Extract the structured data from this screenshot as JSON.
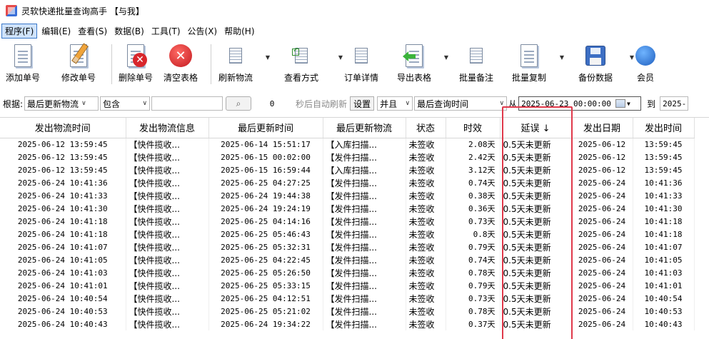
{
  "window": {
    "title": "灵软快递批量查询高手 【与我】"
  },
  "menu": [
    {
      "label": "程序(F)",
      "active": true
    },
    {
      "label": "编辑(E)"
    },
    {
      "label": "查看(S)"
    },
    {
      "label": "数据(B)"
    },
    {
      "label": "工具(T)"
    },
    {
      "label": "公告(X)"
    },
    {
      "label": "帮助(H)"
    }
  ],
  "toolbar": {
    "add": "添加单号",
    "edit": "修改单号",
    "delete": "删除单号",
    "clear": "清空表格",
    "refresh": "刷新物流",
    "view_mode": "查看方式",
    "order_detail": "订单详情",
    "export": "导出表格",
    "batch_note": "批量备注",
    "batch_copy": "批量复制",
    "backup": "备份数据",
    "member": "会员"
  },
  "filter": {
    "basis_label": "根据:",
    "field": "最后更新物流",
    "operator": "包含",
    "value": "",
    "count": "0",
    "auto_refresh": "秒后自动刷新",
    "settings_btn": "设置",
    "logic": "并且",
    "date_field": "最后查询时间",
    "from_label": "从",
    "from_date": "2025-06-23 00:00:00",
    "to_label": "到",
    "to_date": "2025-"
  },
  "table": {
    "headers": [
      "发出物流时间",
      "发出物流信息",
      "最后更新时间",
      "最后更新物流",
      "状态",
      "时效",
      "延误 ↓",
      "发出日期",
      "发出时间"
    ],
    "rows": [
      [
        "2025-06-12 13:59:45",
        "【快件揽收...",
        "2025-06-14 15:51:17",
        "【入库扫描...",
        "未签收",
        "2.08天",
        "0.5天未更新",
        "2025-06-12",
        "13:59:45"
      ],
      [
        "2025-06-12 13:59:45",
        "【快件揽收...",
        "2025-06-15 00:02:00",
        "【发件扫描...",
        "未签收",
        "2.42天",
        "0.5天未更新",
        "2025-06-12",
        "13:59:45"
      ],
      [
        "2025-06-12 13:59:45",
        "【快件揽收...",
        "2025-06-15 16:59:44",
        "【入库扫描...",
        "未签收",
        "3.12天",
        "0.5天未更新",
        "2025-06-12",
        "13:59:45"
      ],
      [
        "2025-06-24 10:41:36",
        "【快件揽收...",
        "2025-06-25 04:27:25",
        "【发件扫描...",
        "未签收",
        "0.74天",
        "0.5天未更新",
        "2025-06-24",
        "10:41:36"
      ],
      [
        "2025-06-24 10:41:33",
        "【快件揽收...",
        "2025-06-24 19:44:38",
        "【发件扫描...",
        "未签收",
        "0.38天",
        "0.5天未更新",
        "2025-06-24",
        "10:41:33"
      ],
      [
        "2025-06-24 10:41:30",
        "【快件揽收...",
        "2025-06-24 19:24:19",
        "【发件扫描...",
        "未签收",
        "0.36天",
        "0.5天未更新",
        "2025-06-24",
        "10:41:30"
      ],
      [
        "2025-06-24 10:41:18",
        "【快件揽收...",
        "2025-06-25 04:14:16",
        "【发件扫描...",
        "未签收",
        "0.73天",
        "0.5天未更新",
        "2025-06-24",
        "10:41:18"
      ],
      [
        "2025-06-24 10:41:18",
        "【快件揽收...",
        "2025-06-25 05:46:43",
        "【发件扫描...",
        "未签收",
        "0.8天",
        "0.5天未更新",
        "2025-06-24",
        "10:41:18"
      ],
      [
        "2025-06-24 10:41:07",
        "【快件揽收...",
        "2025-06-25 05:32:31",
        "【发件扫描...",
        "未签收",
        "0.79天",
        "0.5天未更新",
        "2025-06-24",
        "10:41:07"
      ],
      [
        "2025-06-24 10:41:05",
        "【快件揽收...",
        "2025-06-25 04:22:45",
        "【发件扫描...",
        "未签收",
        "0.74天",
        "0.5天未更新",
        "2025-06-24",
        "10:41:05"
      ],
      [
        "2025-06-24 10:41:03",
        "【快件揽收...",
        "2025-06-25 05:26:50",
        "【发件扫描...",
        "未签收",
        "0.78天",
        "0.5天未更新",
        "2025-06-24",
        "10:41:03"
      ],
      [
        "2025-06-24 10:41:01",
        "【快件揽收...",
        "2025-06-25 05:33:15",
        "【发件扫描...",
        "未签收",
        "0.79天",
        "0.5天未更新",
        "2025-06-24",
        "10:41:01"
      ],
      [
        "2025-06-24 10:40:54",
        "【快件揽收...",
        "2025-06-25 04:12:51",
        "【发件扫描...",
        "未签收",
        "0.73天",
        "0.5天未更新",
        "2025-06-24",
        "10:40:54"
      ],
      [
        "2025-06-24 10:40:53",
        "【快件揽收...",
        "2025-06-25 05:21:02",
        "【发件扫描...",
        "未签收",
        "0.78天",
        "0.5天未更新",
        "2025-06-24",
        "10:40:53"
      ],
      [
        "2025-06-24 10:40:43",
        "【快件揽收...",
        "2025-06-24 19:34:22",
        "【发件扫描...",
        "未签收",
        "0.37天",
        "0.5天未更新",
        "2025-06-24",
        "10:40:43"
      ]
    ]
  },
  "colors": {
    "highlight": "#e0394b",
    "menu_active": "#cfe3fb"
  }
}
